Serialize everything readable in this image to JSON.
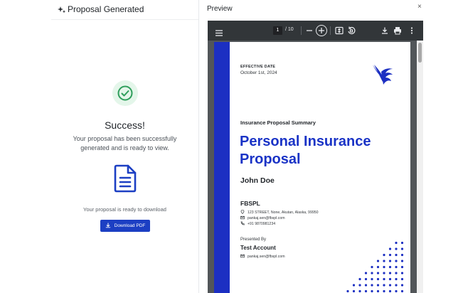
{
  "left_panel": {
    "header_title": "Proposal Generated",
    "success_title": "Success!",
    "success_message": "Your proposal has been successfully generated and is ready to view.",
    "ready_text": "Your proposal is ready to download",
    "download_label": "Download PDF"
  },
  "right_panel": {
    "title": "Preview",
    "close_label": "×"
  },
  "viewer": {
    "current_page": "1",
    "total_pages": "/ 10"
  },
  "pdf": {
    "effective_label": "EFFECTIVE DATE",
    "effective_date": "October 1st, 2024",
    "summary_label": "Insurance Proposal Summary",
    "title": "Personal Insurance Proposal",
    "customer_name": "John Doe",
    "company_name": "FBSPL",
    "address": "123 STREET, None, Akutan, Alaska, 99950",
    "email": "pankaj.sen@fbspl.com",
    "phone": "+91 9870981234",
    "presented_by_label": "Presented By",
    "presenter_name": "Test Account",
    "presenter_email": "pankaj.sen@fbspl.com"
  },
  "colors": {
    "brand_blue": "#1c2fc2",
    "button_blue": "#1c3fc3",
    "success_green": "#2e9e5b"
  },
  "icons": [
    "sparkle-icon",
    "check-circle-icon",
    "document-icon",
    "download-icon",
    "menu-icon",
    "zoom-out-icon",
    "zoom-in-icon",
    "fit-page-icon",
    "rotate-icon",
    "print-icon",
    "more-vertical-icon",
    "location-icon",
    "email-icon",
    "phone-icon",
    "bird-logo"
  ]
}
